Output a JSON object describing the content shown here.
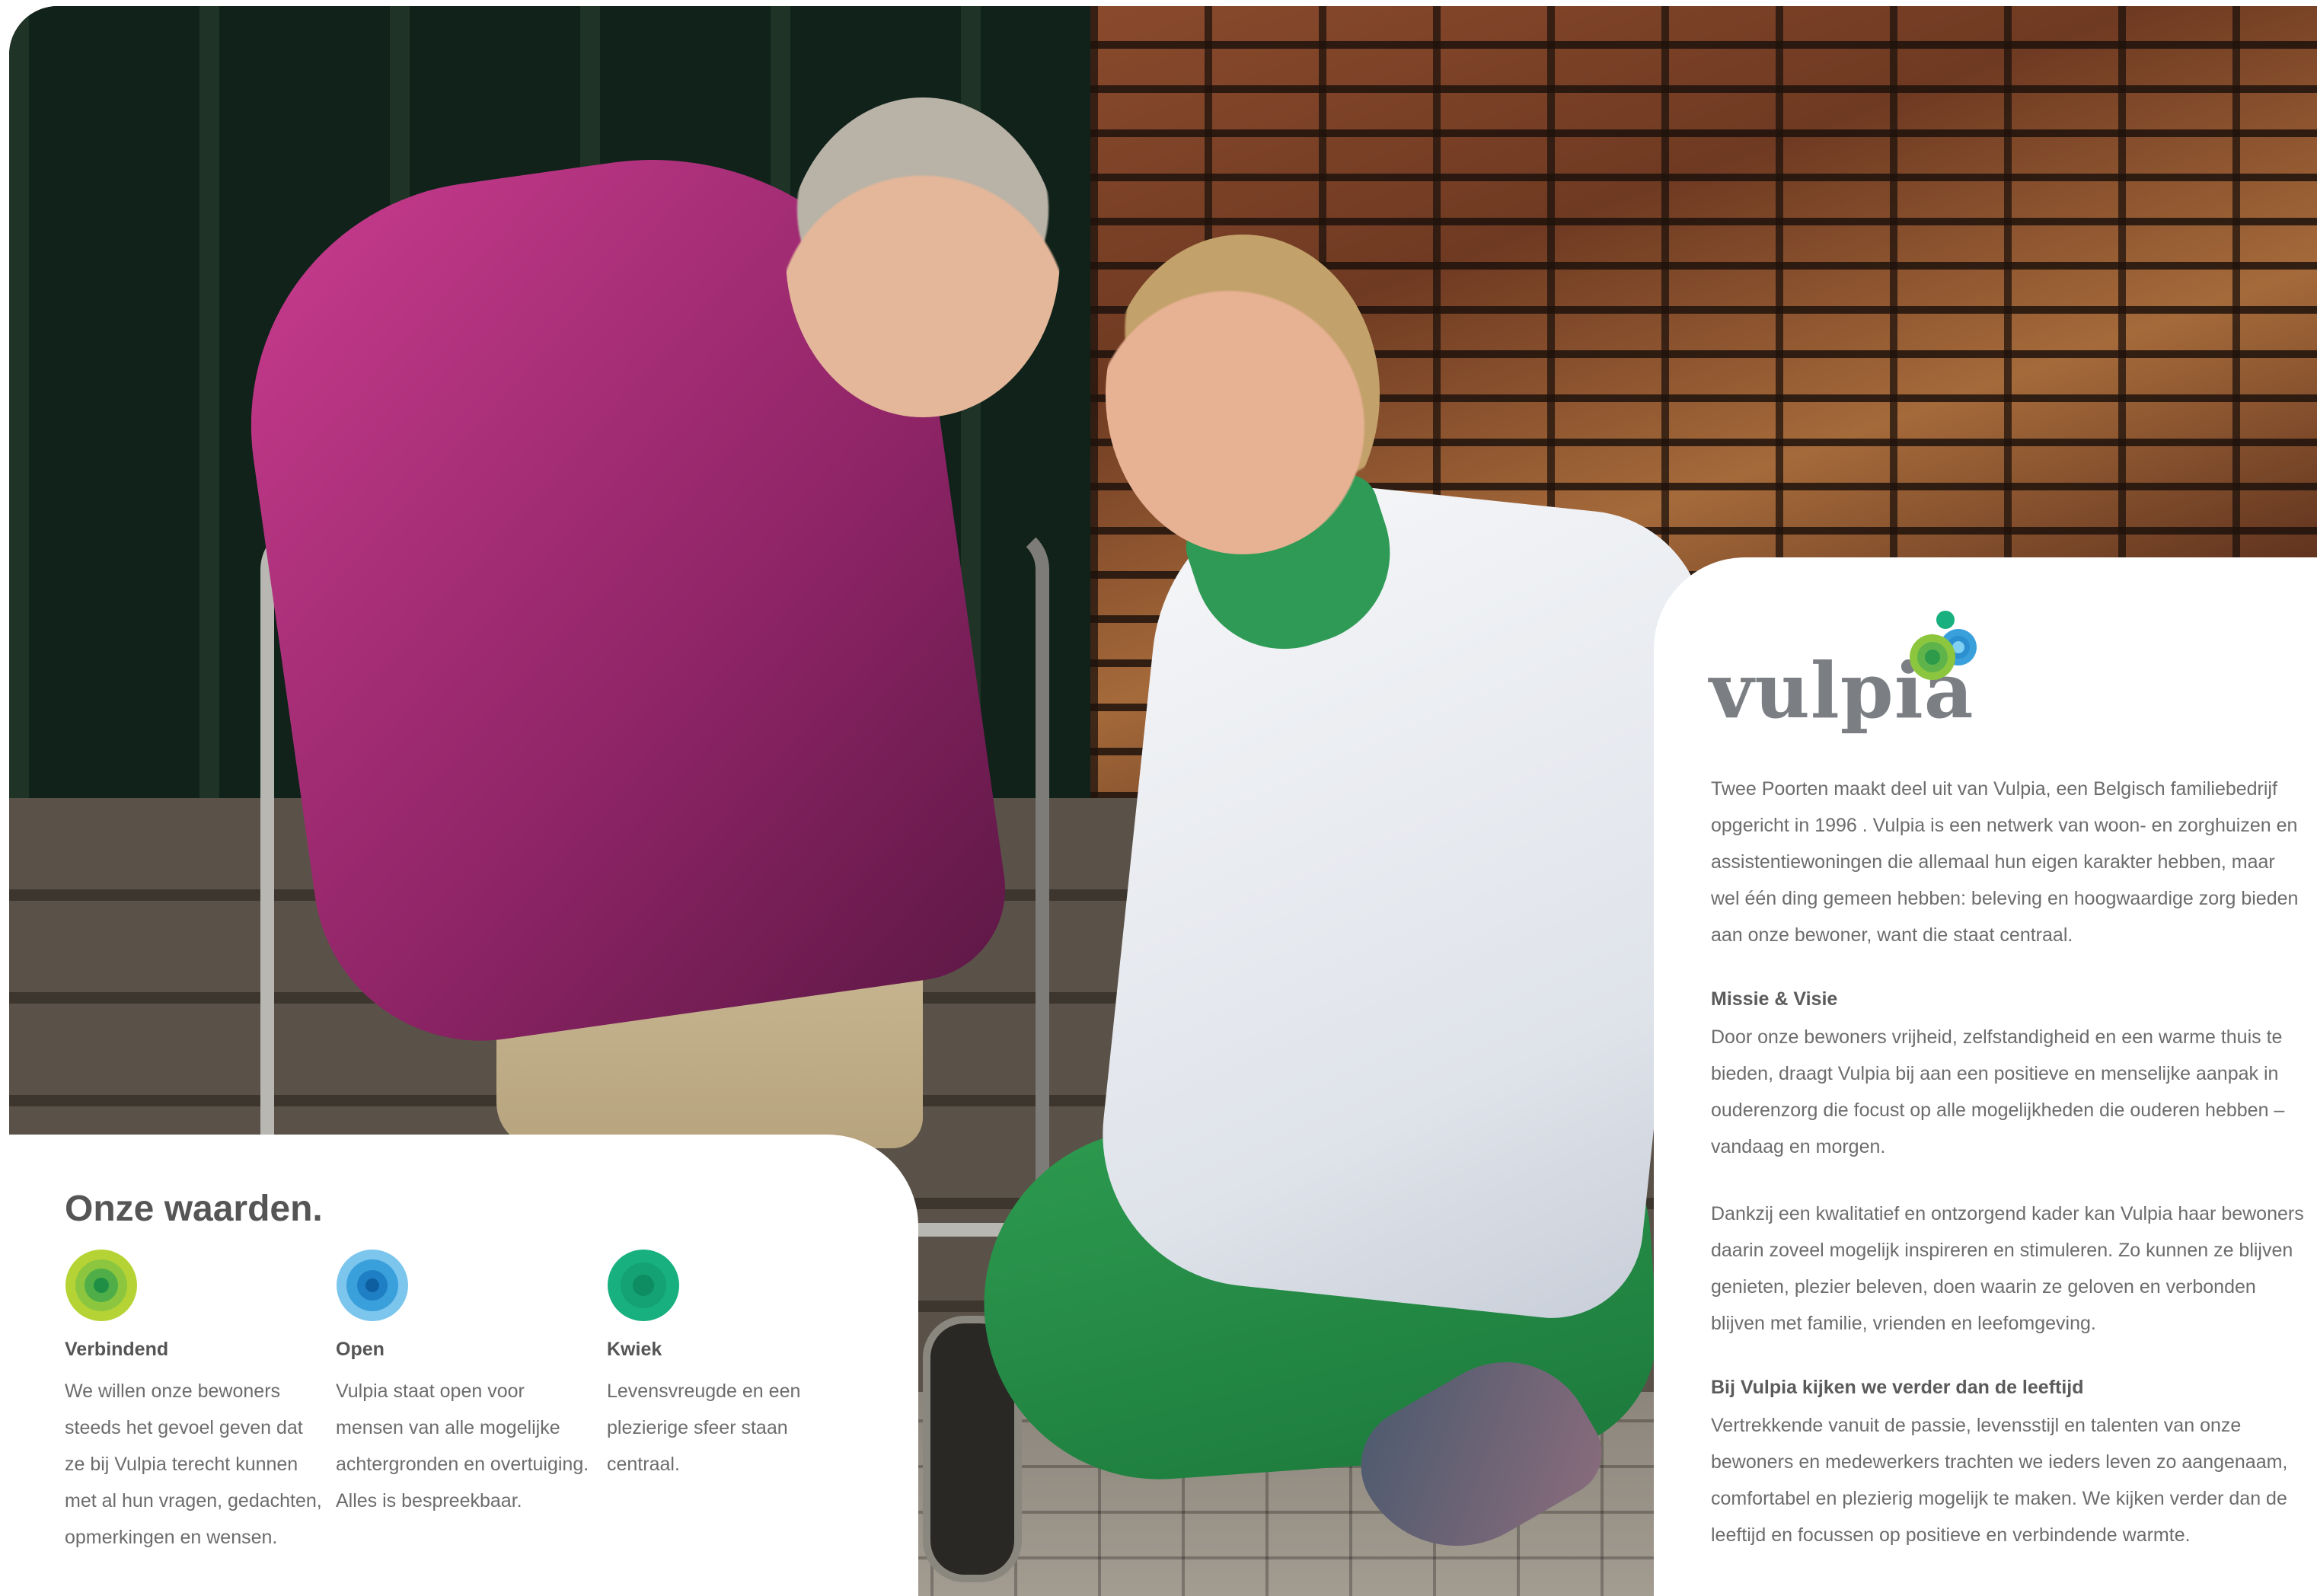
{
  "logo": {
    "wordmark": "vulpia"
  },
  "intro": "Twee Poorten maakt deel uit van Vulpia, een Belgisch familiebedrijf opgericht in 1996 . Vulpia is een netwerk van woon- en zorghuizen en assistentiewoningen die allemaal hun eigen karakter hebben, maar wel één ding gemeen hebben: beleving en hoogwaardige zorg bieden aan onze bewoner, want die staat centraal.",
  "mission": {
    "heading": "Missie & Visie",
    "paragraph1": "Door onze bewoners vrijheid, zelfstandigheid en een warme thuis te bieden, draagt Vulpia bij aan een positieve en menselijke aanpak in ouderenzorg die focust op alle mogelijkheden die ouderen hebben – vandaag en morgen.",
    "paragraph2": "Dankzij een kwalitatief en ontzorgend kader kan Vulpia haar bewoners daarin zoveel mogelijk inspireren en stimuleren. Zo kunnen ze blijven genieten, plezier beleven, doen waarin ze geloven en verbonden blijven met familie, vrienden en leefomgeving."
  },
  "beyond_age": {
    "heading": "Bij Vulpia kijken we verder dan de leeftijd",
    "paragraph": "Vertrekkende vanuit de passie, levensstijl en talenten van onze bewoners en medewerkers trachten we ieders leven zo aangenaam, comfortabel en plezierig mogelijk te maken. We kijken verder dan de leeftijd en focussen op positieve en verbindende warmte."
  },
  "values": {
    "title": "Onze waarden.",
    "items": [
      {
        "name": "Verbindend",
        "description": "We willen onze bewoners steeds het gevoel geven dat ze bij Vulpia terecht kunnen met al hun vragen, gedachten, opmerkingen en wensen.",
        "icon": "green-concentric-circle-icon",
        "color": "#8cc63f"
      },
      {
        "name": "Open",
        "description": "Vulpia staat open voor mensen van alle mogelijke achtergronden en overtuiging. Alles is bespreekbaar.",
        "icon": "blue-concentric-circle-icon",
        "color": "#3aa0dc"
      },
      {
        "name": "Kwiek",
        "description": "Levensvreugde en een plezierige sfeer staan centraal.",
        "icon": "teal-concentric-circle-icon",
        "color": "#17b07e"
      }
    ]
  },
  "colors": {
    "text": "#6c6c6c",
    "heading": "#555555",
    "logo_gray": "#7b7e83",
    "green": "#8cc63f",
    "blue": "#3aa0dc",
    "teal": "#17b07e"
  }
}
